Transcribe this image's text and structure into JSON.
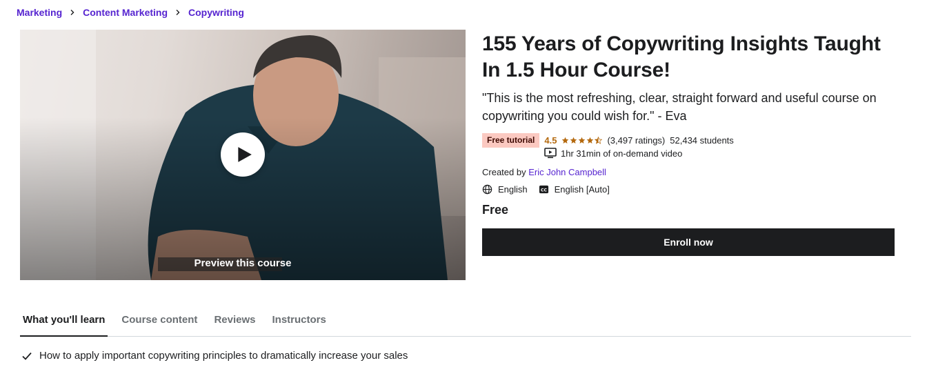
{
  "breadcrumb": [
    {
      "label": "Marketing"
    },
    {
      "label": "Content Marketing"
    },
    {
      "label": "Copywriting"
    }
  ],
  "preview": {
    "label": "Preview this course"
  },
  "course": {
    "title": "155 Years of Copywriting Insights Taught In 1.5 Hour Course!",
    "headline": "\"This is the most refreshing, clear, straight forward and useful course on copywriting you could wish for.\" - Eva",
    "badge": "Free tutorial",
    "rating": "4.5",
    "stars_value": 4.5,
    "ratings_count": "(3,497 ratings)",
    "students": "52,434 students",
    "duration": "1hr 31min of on-demand video",
    "created_by_label": "Created by",
    "instructor": "Eric John Campbell",
    "language": "English",
    "captions": "English [Auto]",
    "price": "Free",
    "enroll_label": "Enroll now"
  },
  "tabs": [
    {
      "label": "What you'll learn",
      "active": true
    },
    {
      "label": "Course content",
      "active": false
    },
    {
      "label": "Reviews",
      "active": false
    },
    {
      "label": "Instructors",
      "active": false
    }
  ],
  "learn": [
    {
      "text": "How to apply important copywriting principles to dramatically increase your sales"
    }
  ],
  "icons": {
    "breadcrumb_sep": "chevron-right-icon",
    "play": "play-icon",
    "star": "star-icon",
    "video": "video-icon",
    "language": "globe-icon",
    "captions": "closed-captions-icon",
    "check": "check-icon"
  },
  "colors": {
    "brand": "#5624d0",
    "rating": "#b4690e",
    "badge_bg": "#fbc9c1",
    "button_bg": "#1c1d1f"
  }
}
